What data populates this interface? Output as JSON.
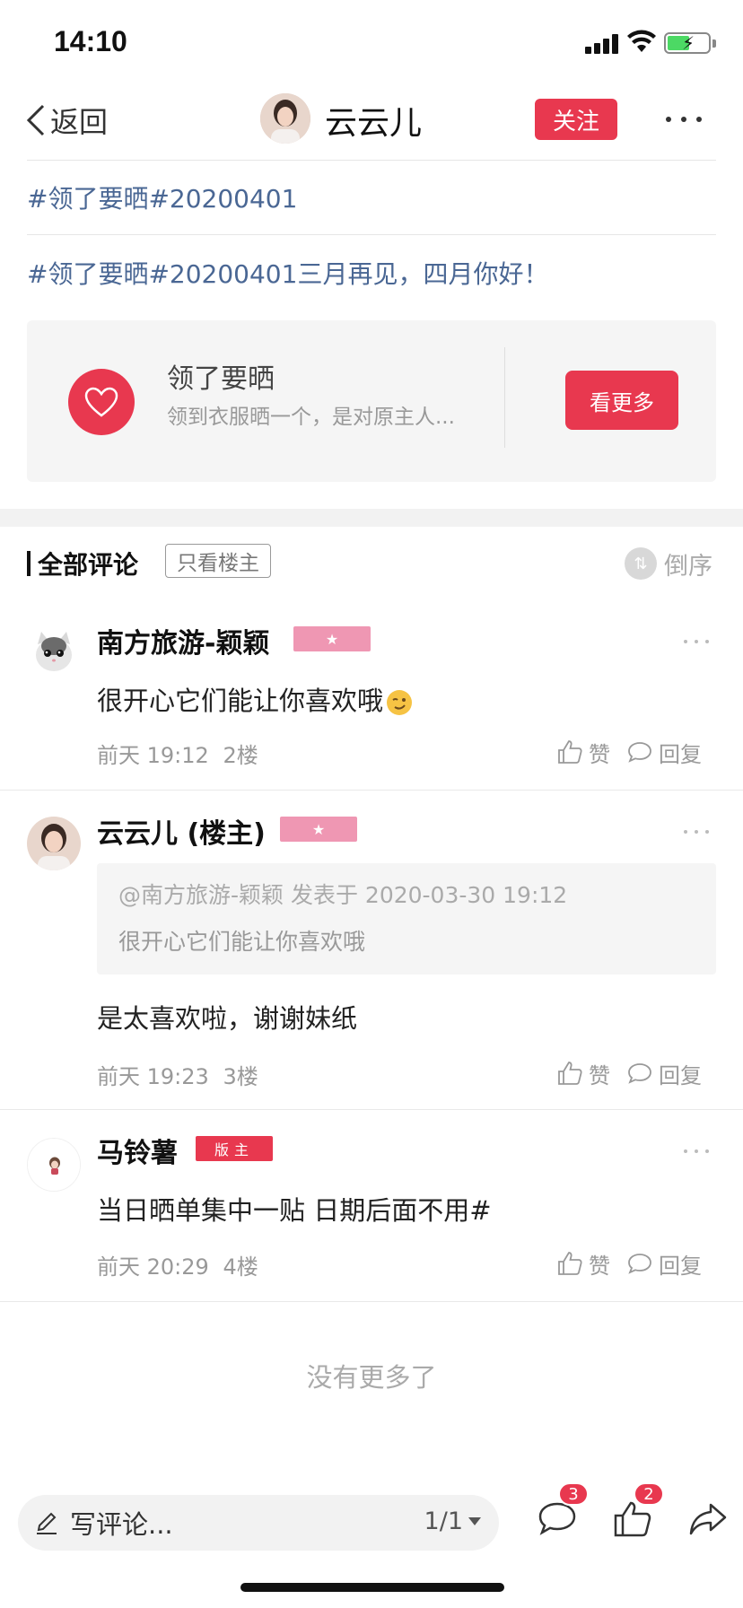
{
  "status": {
    "time": "14:10"
  },
  "nav": {
    "back_label": "返回",
    "title": "云云儿",
    "follow_label": "关注"
  },
  "post": {
    "tag_title": "#领了要晒#20200401",
    "body": "#领了要晒#20200401三月再见，四月你好！"
  },
  "topic_card": {
    "name": "领了要晒",
    "description": "领到衣服晒一个，是对原主人...",
    "more_label": "看更多"
  },
  "comments_header": {
    "title": "全部评论",
    "filter_label": "只看楼主",
    "sort_label": "倒序"
  },
  "comments": [
    {
      "name": "南方旅游-颖颖",
      "badge": "★",
      "text": "很开心它们能让你喜欢哦",
      "time": "前天 19:12",
      "floor": "2楼",
      "like_label": "赞",
      "reply_label": "回复"
    },
    {
      "name": "云云儿 (楼主)",
      "badge": "★",
      "quote_meta": "@南方旅游-颖颖 发表于 2020-03-30 19:12",
      "quote_text": "很开心它们能让你喜欢哦",
      "text": "是太喜欢啦，谢谢妹纸",
      "time": "前天 19:23",
      "floor": "3楼",
      "like_label": "赞",
      "reply_label": "回复"
    },
    {
      "name": "马铃薯",
      "badge": "版主",
      "text": "当日晒单集中一贴 日期后面不用#",
      "time": "前天 20:29",
      "floor": "4楼",
      "like_label": "赞",
      "reply_label": "回复"
    }
  ],
  "footer": {
    "no_more": "没有更多了"
  },
  "bottom_bar": {
    "input_placeholder": "写评论...",
    "page_indicator": "1/1",
    "comment_count": "3",
    "like_count": "2"
  },
  "colors": {
    "accent": "#e8384f",
    "link": "#4a6794",
    "badge_pink": "#ef97b3"
  }
}
